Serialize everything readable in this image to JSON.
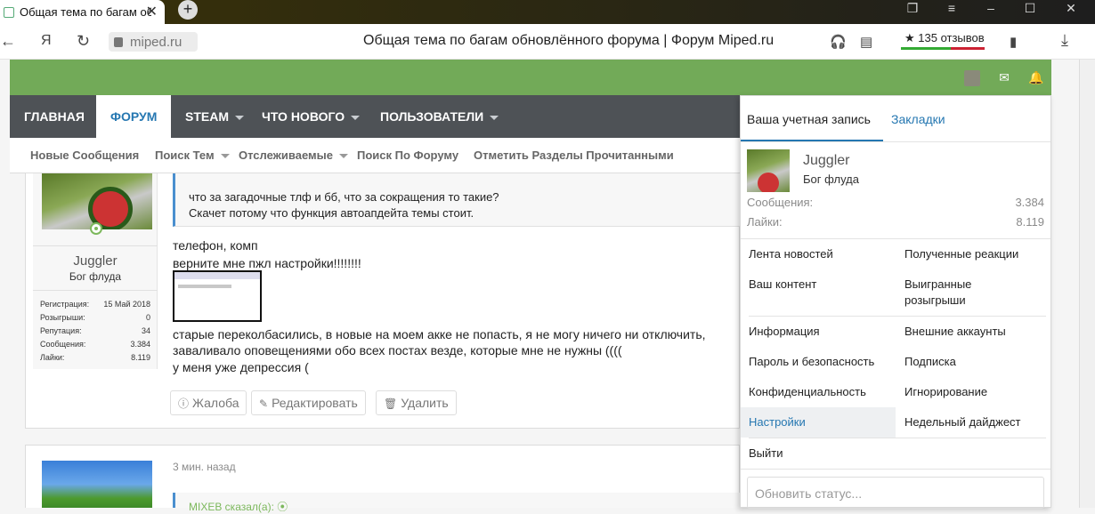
{
  "browser": {
    "tab_title": "Общая тема по багам обновлённого форума",
    "tab_close": "✕",
    "new_tab": "+",
    "url": "miped.ru",
    "page_title": "Общая тема по багам обновлённого форума | Форум Miped.ru",
    "reviews": "★ 135 отзывов",
    "yandex": "Я"
  },
  "nav": {
    "items": [
      {
        "label": "ГЛАВНАЯ"
      },
      {
        "label": "ФОРУМ"
      },
      {
        "label": "STEAM"
      },
      {
        "label": "ЧТО НОВОГО"
      },
      {
        "label": "ПОЛЬЗОВАТЕЛИ"
      }
    ],
    "subnav": [
      {
        "label": "Новые Сообщения"
      },
      {
        "label": "Поиск Тем"
      },
      {
        "label": "Отслеживаемые"
      },
      {
        "label": "Поиск По Форуму"
      },
      {
        "label": "Отметить Разделы Прочитанными"
      }
    ]
  },
  "post1": {
    "author": "Juggler",
    "title": "Бог флуда",
    "stats": [
      {
        "label": "Регистрация:",
        "value": "15 Май 2018"
      },
      {
        "label": "Розыгрыши:",
        "value": "0"
      },
      {
        "label": "Репутация:",
        "value": "34"
      },
      {
        "label": "Сообщения:",
        "value": "3.384"
      },
      {
        "label": "Лайки:",
        "value": "8.119"
      }
    ],
    "quote_line1": "что за загадочные тлф и бб, что за сокращения то такие?",
    "quote_line2": "Скачет потому что функция автоапдейта темы стоит.",
    "line1": "телефон, комп",
    "line2": "верните мне пжл настройки!!!!!!!!",
    "line3": "старые переколбасились, в новые на моем акке не попасть, я не могу ничего ни отключить,",
    "line4": "заваливало оповещениями обо всех постах везде, которые мне не нужны ((((",
    "line5": "у меня уже депрессия (",
    "actions": {
      "report": "Жалоба",
      "edit": "Редактировать",
      "delete": "Удалить"
    }
  },
  "post2": {
    "time": "3 мин. назад",
    "quote_author": "MIXEB сказал(а): ⦿"
  },
  "account_menu": {
    "tab_account": "Ваша учетная запись",
    "tab_bookmarks": "Закладки",
    "username": "Juggler",
    "role": "Бог флуда",
    "messages_label": "Сообщения:",
    "messages_value": "3.384",
    "likes_label": "Лайки:",
    "likes_value": "8.119",
    "items": {
      "news_feed": "Лента новостей",
      "reactions": "Полученные реакции",
      "your_content": "Ваш контент",
      "won_giveaways": "Выигранные розыгрыши",
      "information": "Информация",
      "external_accounts": "Внешние аккаунты",
      "password_security": "Пароль и безопасность",
      "subscription": "Подписка",
      "privacy": "Конфиденциальность",
      "ignoring": "Игнорирование",
      "settings": "Настройки",
      "weekly_digest": "Недельный дайджест",
      "logout": "Выйти"
    },
    "status_placeholder": "Обновить статус..."
  }
}
